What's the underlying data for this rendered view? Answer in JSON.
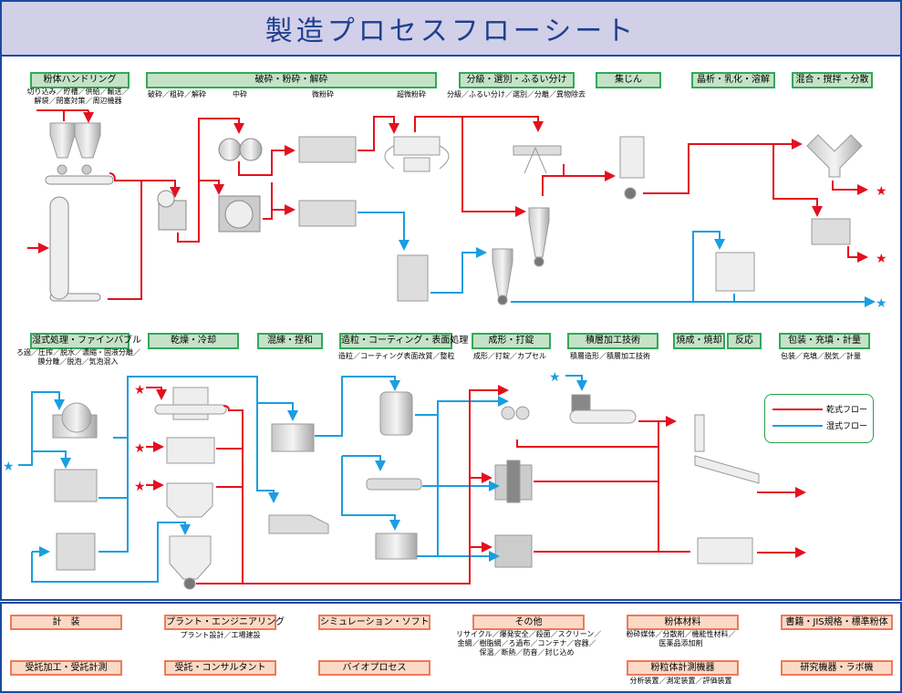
{
  "title": "製造プロセスフローシート",
  "colors": {
    "dry_flow": "#e3101f",
    "wet_flow": "#1a9ee0",
    "title_bg": "#d2cfe8",
    "border": "#1a4aa0",
    "category_bg": "#c4e3c6",
    "category_border": "#33a85a",
    "service_bg": "#fbd9c5",
    "service_border": "#ec7a5e"
  },
  "top_categories": [
    {
      "label": "粉体ハンドリング",
      "sub": [
        "切り込み／貯槽／供給／輸送／",
        "解袋／閉塞対策／周辺機器"
      ]
    },
    {
      "label": "破砕・粉砕・解砕",
      "sub_items": [
        "破砕／粗砕／解砕",
        "中砕",
        "微粉砕",
        "超微粉砕"
      ]
    },
    {
      "label": "分級・選別・ふるい分け",
      "sub": [
        "分級／ふるい分け／選別／分離／異物除去"
      ]
    },
    {
      "label": "集じん"
    },
    {
      "label": "晶析・乳化・溶解"
    },
    {
      "label": "混合・撹拌・分散"
    }
  ],
  "middle_categories": [
    {
      "label": "湿式処理・ファインバブル",
      "sub": [
        "ろ過／圧搾／脱水／濃縮・固液分離／",
        "膜分離／脱泡／気泡混入"
      ]
    },
    {
      "label": "乾燥・冷却"
    },
    {
      "label": "混練・捏和"
    },
    {
      "label": "造粒・コーティング・表面処理",
      "sub": [
        "造粒／コーティング表面改質／整粒"
      ]
    },
    {
      "label": "成形・打錠",
      "sub": [
        "成形／打錠／カプセル"
      ]
    },
    {
      "label": "積層加工技術",
      "sub": [
        "積層造形／積層加工技術"
      ]
    },
    {
      "label": "焼成・焼却"
    },
    {
      "label": "反応"
    },
    {
      "label": "包装・充填・計量",
      "sub": [
        "包装／充填／脱気／計量"
      ]
    }
  ],
  "legend": {
    "dry_label": "乾式フロー",
    "wet_label": "湿式フロー"
  },
  "services": [
    {
      "label": "計　装"
    },
    {
      "label": "プラント・エンジニアリング",
      "sub": [
        "プラント設計／工場建設"
      ]
    },
    {
      "label": "シミュレーション・ソフト"
    },
    {
      "label": "その他",
      "sub": [
        "リサイクル／爆発安全／殺菌／スクリーン／",
        "金網／樹脂網／ろ過布／コンテナ／容器／",
        "保温／断熱／防音／封じ込め"
      ]
    },
    {
      "label": "粉体材料",
      "sub": [
        "粉砕媒体／分散剤／機能性材料／",
        "医薬品添加剤"
      ]
    },
    {
      "label": "書籍・JIS規格・標準粉体"
    },
    {
      "label": "受託加工・受託計測"
    },
    {
      "label": "受託・コンサルタント"
    },
    {
      "label": "バイオプロセス"
    },
    {
      "label": "粉粒体計測機器",
      "sub": [
        "分析装置／測定装置／評価装置"
      ]
    },
    {
      "label": "研究機器・ラボ機"
    }
  ]
}
